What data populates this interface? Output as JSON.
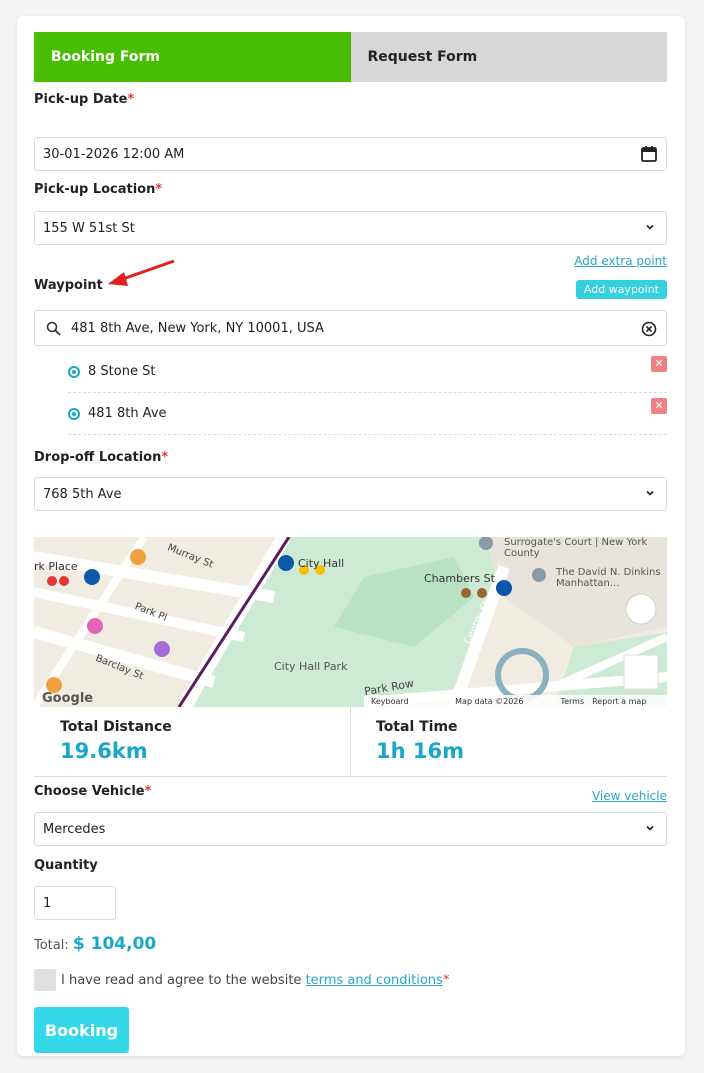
{
  "tabs": {
    "booking": "Booking Form",
    "request": "Request Form"
  },
  "pickup_date": {
    "label": "Pick-up Date",
    "value": "30-01-2026 12:00 AM"
  },
  "pickup_location": {
    "label": "Pick-up Location",
    "value": "155 W 51st St"
  },
  "waypoint": {
    "add_extra_point": "Add extra point",
    "label": "Waypoint",
    "add_button": "Add waypoint",
    "search_value": "481 8th Ave, New York, NY 10001, USA",
    "items": [
      "8 Stone St",
      "481 8th Ave"
    ],
    "remove_label": "✕"
  },
  "dropoff_location": {
    "label": "Drop-off Location",
    "value": "768 5th Ave"
  },
  "map": {
    "labels": {
      "surrogate": "Surrogate's Court | New York County",
      "city_hall": "City Hall",
      "chambers": "Chambers St",
      "dinkins": "The David N. Dinkins Manhattan...",
      "park_place": "Park Pl",
      "murray": "Murray St",
      "barclay": "Barclay St",
      "city_hall_park": "City Hall Park",
      "park_row": "Park Row",
      "centre": "Centre St",
      "park_place_left": "rk Place"
    },
    "footer": {
      "shortcuts": "Keyboard shortcuts",
      "mapdata": "Map data ©2026 Google",
      "terms": "Terms",
      "report": "Report a map error"
    },
    "logo": "Google"
  },
  "stats": {
    "distance_label": "Total Distance",
    "distance_value": "19.6km",
    "time_label": "Total Time",
    "time_value": "1h 16m"
  },
  "vehicle": {
    "label": "Choose Vehicle",
    "view_link": "View vehicle",
    "value": "Mercedes"
  },
  "quantity": {
    "label": "Quantity",
    "value": "1"
  },
  "total": {
    "prefix": "Total:",
    "value": "$ 104,00"
  },
  "terms": {
    "text": "I have read and agree to the website",
    "link": "terms and conditions"
  },
  "submit": "Booking",
  "colors": {
    "accent": "#1aa7c6",
    "tab_active": "#47bd04",
    "button": "#35d8e8"
  }
}
